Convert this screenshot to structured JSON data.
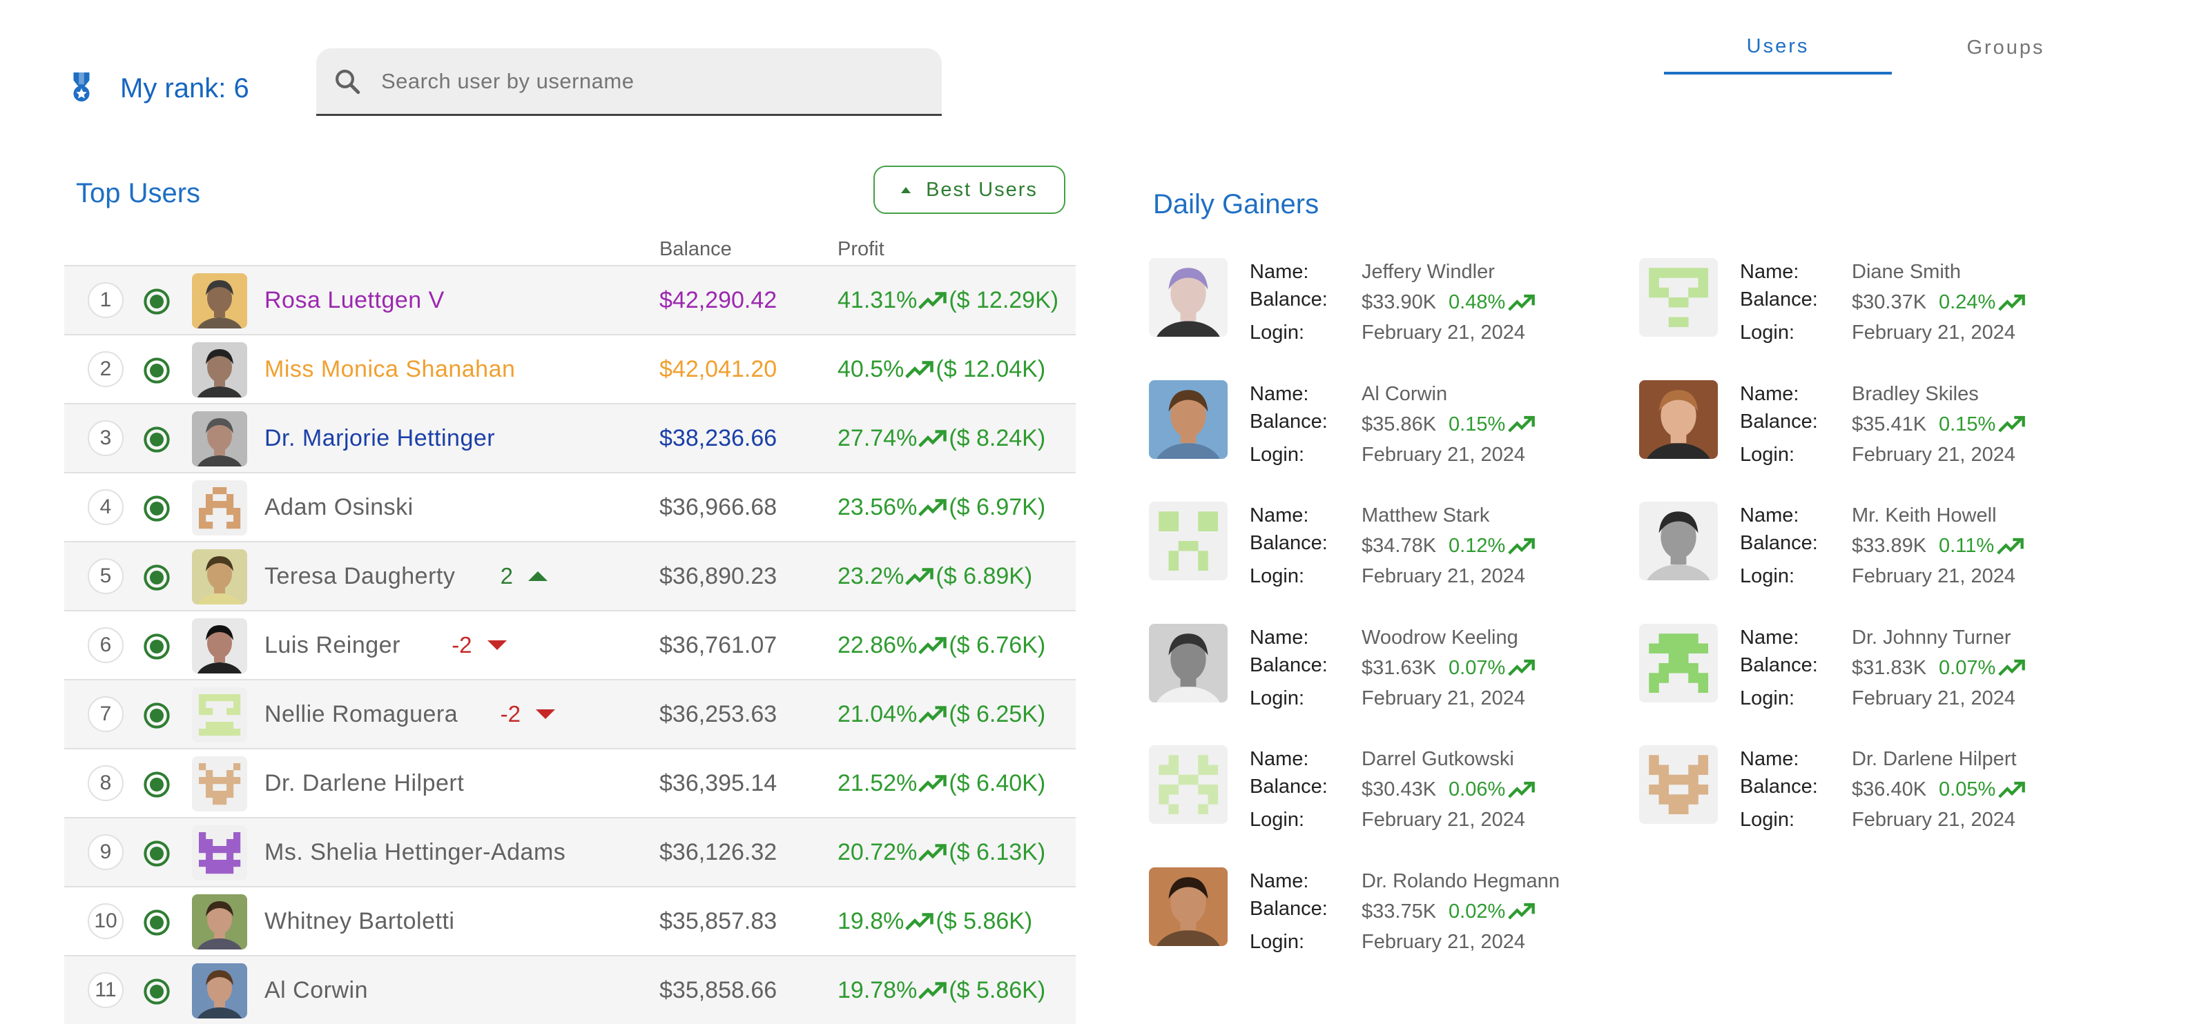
{
  "header": {
    "rank_label": "My rank: 6",
    "search_placeholder": "Search user by username",
    "tabs": [
      {
        "label": "Users",
        "active": true
      },
      {
        "label": "Groups",
        "active": false
      }
    ]
  },
  "top_users": {
    "title": "Top Users",
    "best_users_label": "Best Users",
    "columns": {
      "balance": "Balance",
      "profit": "Profit"
    },
    "rows": [
      {
        "rank": "1",
        "name": "Rosa Luettgen V",
        "balance": "$42,290.42",
        "profit": "41.31%",
        "profit_amount": "($ 12.29K)",
        "color": "#9c27b0",
        "avatar": "photo-goggles",
        "change": null
      },
      {
        "rank": "2",
        "name": "Miss Monica Shanahan",
        "balance": "$42,041.20",
        "profit": "40.5%",
        "profit_amount": "($ 12.04K)",
        "color": "#f0a030",
        "avatar": "photo-beanie",
        "change": null
      },
      {
        "rank": "3",
        "name": "Dr. Marjorie Hettinger",
        "balance": "$38,236.66",
        "profit": "27.74%",
        "profit_amount": "($ 8.24K)",
        "color": "#1a3fa8",
        "avatar": "photo-man",
        "change": null
      },
      {
        "rank": "4",
        "name": "Adam Osinski",
        "balance": "$36,966.68",
        "profit": "23.56%",
        "profit_amount": "($ 6.97K)",
        "color": "#616161",
        "avatar": "pixel-orange",
        "change": null
      },
      {
        "rank": "5",
        "name": "Teresa Daugherty",
        "balance": "$36,890.23",
        "profit": "23.2%",
        "profit_amount": "($ 6.89K)",
        "color": "#616161",
        "avatar": "photo-curly",
        "change": {
          "value": "2",
          "dir": "up"
        }
      },
      {
        "rank": "6",
        "name": "Luis Reinger",
        "balance": "$36,761.07",
        "profit": "22.86%",
        "profit_amount": "($ 6.76K)",
        "color": "#616161",
        "avatar": "photo-hat",
        "change": {
          "value": "-2",
          "dir": "down"
        }
      },
      {
        "rank": "7",
        "name": "Nellie Romaguera",
        "balance": "$36,253.63",
        "profit": "21.04%",
        "profit_amount": "($ 6.25K)",
        "color": "#616161",
        "avatar": "pixel-lime",
        "change": {
          "value": "-2",
          "dir": "down"
        }
      },
      {
        "rank": "8",
        "name": "Dr. Darlene Hilpert",
        "balance": "$36,395.14",
        "profit": "21.52%",
        "profit_amount": "($ 6.40K)",
        "color": "#616161",
        "avatar": "pixel-tan",
        "change": null
      },
      {
        "rank": "9",
        "name": "Ms. Shelia Hettinger-Adams",
        "balance": "$36,126.32",
        "profit": "20.72%",
        "profit_amount": "($ 6.13K)",
        "color": "#616161",
        "avatar": "pixel-purple",
        "change": null
      },
      {
        "rank": "10",
        "name": "Whitney Bartoletti",
        "balance": "$35,857.83",
        "profit": "19.8%",
        "profit_amount": "($ 5.86K)",
        "color": "#616161",
        "avatar": "photo-glasses",
        "change": null
      },
      {
        "rank": "11",
        "name": "Al Corwin",
        "balance": "$35,858.66",
        "profit": "19.78%",
        "profit_amount": "($ 5.86K)",
        "color": "#616161",
        "avatar": "photo-man2",
        "change": null
      }
    ]
  },
  "daily_gainers": {
    "title": "Daily Gainers",
    "labels": {
      "name": "Name:",
      "balance": "Balance:",
      "login": "Login:"
    },
    "items": [
      {
        "name": "Jeffery Windler",
        "balance": "$33.90K",
        "pct": "0.48%",
        "login": "February 21, 2024",
        "avatar": "photo-purplehair"
      },
      {
        "name": "Diane Smith",
        "balance": "$30.37K",
        "pct": "0.24%",
        "login": "February 21, 2024",
        "avatar": "pixel-lime2"
      },
      {
        "name": "Al Corwin",
        "balance": "$35.86K",
        "pct": "0.15%",
        "login": "February 21, 2024",
        "avatar": "photo-beach"
      },
      {
        "name": "Bradley Skiles",
        "balance": "$35.41K",
        "pct": "0.15%",
        "login": "February 21, 2024",
        "avatar": "photo-smile"
      },
      {
        "name": "Matthew Stark",
        "balance": "$34.78K",
        "pct": "0.12%",
        "login": "February 21, 2024",
        "avatar": "pixel-lime3"
      },
      {
        "name": "Mr. Keith Howell",
        "balance": "$33.89K",
        "pct": "0.11%",
        "login": "February 21, 2024",
        "avatar": "photo-bw"
      },
      {
        "name": "Woodrow Keeling",
        "balance": "$31.63K",
        "pct": "0.07%",
        "login": "February 21, 2024",
        "avatar": "photo-guitar"
      },
      {
        "name": "Dr. Johnny Turner",
        "balance": "$31.83K",
        "pct": "0.07%",
        "login": "February 21, 2024",
        "avatar": "pixel-green"
      },
      {
        "name": "Darrel Gutkowski",
        "balance": "$30.43K",
        "pct": "0.06%",
        "login": "February 21, 2024",
        "avatar": "pixel-lime4"
      },
      {
        "name": "Dr. Darlene Hilpert",
        "balance": "$36.40K",
        "pct": "0.05%",
        "login": "February 21, 2024",
        "avatar": "pixel-tan2"
      },
      {
        "name": "Dr. Rolando Hegmann",
        "balance": "$33.75K",
        "pct": "0.02%",
        "login": "February 21, 2024",
        "avatar": "photo-young"
      }
    ]
  },
  "colors": {
    "primary": "#1e6fc4",
    "positive": "#2e9b30",
    "negative": "#c62828"
  }
}
